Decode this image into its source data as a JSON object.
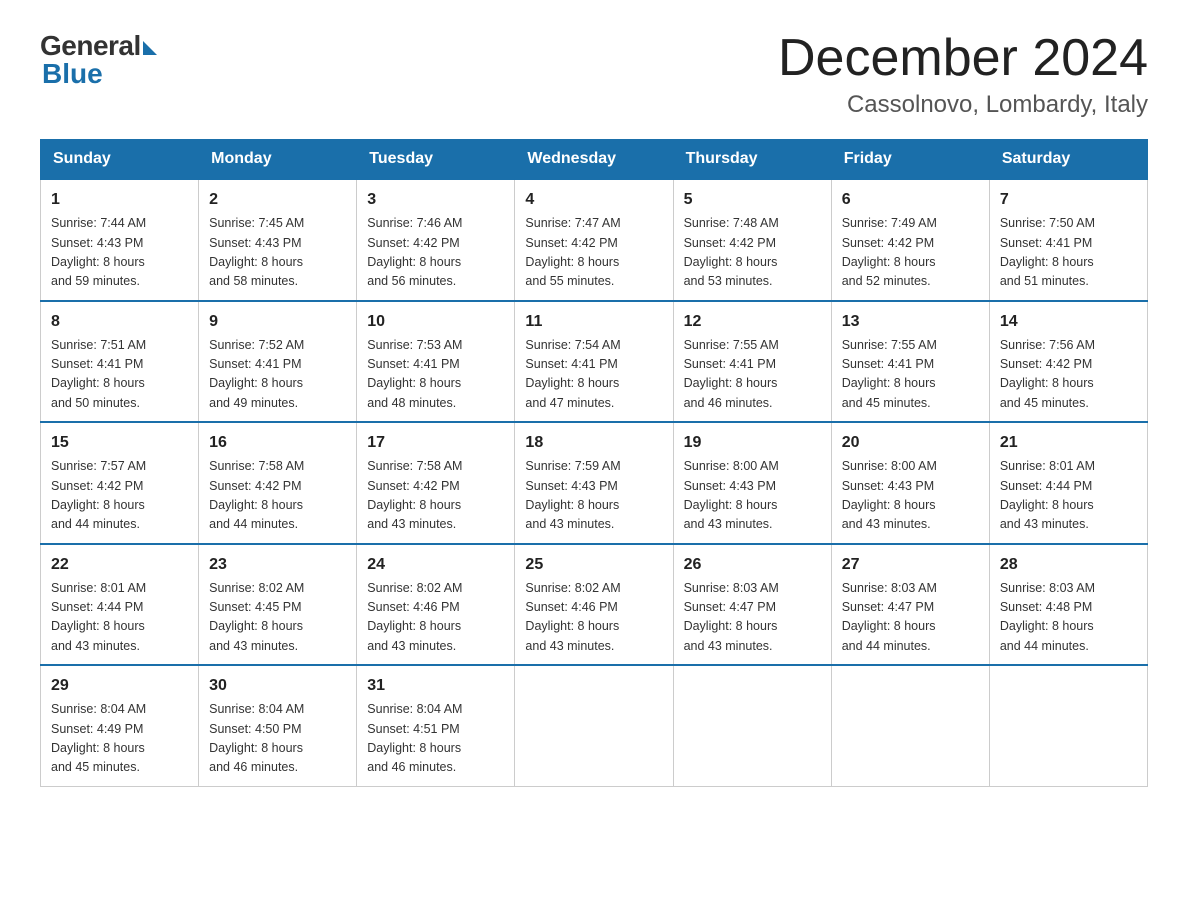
{
  "header": {
    "logo_general": "General",
    "logo_blue": "Blue",
    "month_title": "December 2024",
    "location": "Cassolnovo, Lombardy, Italy"
  },
  "days_of_week": [
    "Sunday",
    "Monday",
    "Tuesday",
    "Wednesday",
    "Thursday",
    "Friday",
    "Saturday"
  ],
  "weeks": [
    [
      {
        "day": "1",
        "sunrise": "7:44 AM",
        "sunset": "4:43 PM",
        "daylight": "8 hours and 59 minutes."
      },
      {
        "day": "2",
        "sunrise": "7:45 AM",
        "sunset": "4:43 PM",
        "daylight": "8 hours and 58 minutes."
      },
      {
        "day": "3",
        "sunrise": "7:46 AM",
        "sunset": "4:42 PM",
        "daylight": "8 hours and 56 minutes."
      },
      {
        "day": "4",
        "sunrise": "7:47 AM",
        "sunset": "4:42 PM",
        "daylight": "8 hours and 55 minutes."
      },
      {
        "day": "5",
        "sunrise": "7:48 AM",
        "sunset": "4:42 PM",
        "daylight": "8 hours and 53 minutes."
      },
      {
        "day": "6",
        "sunrise": "7:49 AM",
        "sunset": "4:42 PM",
        "daylight": "8 hours and 52 minutes."
      },
      {
        "day": "7",
        "sunrise": "7:50 AM",
        "sunset": "4:41 PM",
        "daylight": "8 hours and 51 minutes."
      }
    ],
    [
      {
        "day": "8",
        "sunrise": "7:51 AM",
        "sunset": "4:41 PM",
        "daylight": "8 hours and 50 minutes."
      },
      {
        "day": "9",
        "sunrise": "7:52 AM",
        "sunset": "4:41 PM",
        "daylight": "8 hours and 49 minutes."
      },
      {
        "day": "10",
        "sunrise": "7:53 AM",
        "sunset": "4:41 PM",
        "daylight": "8 hours and 48 minutes."
      },
      {
        "day": "11",
        "sunrise": "7:54 AM",
        "sunset": "4:41 PM",
        "daylight": "8 hours and 47 minutes."
      },
      {
        "day": "12",
        "sunrise": "7:55 AM",
        "sunset": "4:41 PM",
        "daylight": "8 hours and 46 minutes."
      },
      {
        "day": "13",
        "sunrise": "7:55 AM",
        "sunset": "4:41 PM",
        "daylight": "8 hours and 45 minutes."
      },
      {
        "day": "14",
        "sunrise": "7:56 AM",
        "sunset": "4:42 PM",
        "daylight": "8 hours and 45 minutes."
      }
    ],
    [
      {
        "day": "15",
        "sunrise": "7:57 AM",
        "sunset": "4:42 PM",
        "daylight": "8 hours and 44 minutes."
      },
      {
        "day": "16",
        "sunrise": "7:58 AM",
        "sunset": "4:42 PM",
        "daylight": "8 hours and 44 minutes."
      },
      {
        "day": "17",
        "sunrise": "7:58 AM",
        "sunset": "4:42 PM",
        "daylight": "8 hours and 43 minutes."
      },
      {
        "day": "18",
        "sunrise": "7:59 AM",
        "sunset": "4:43 PM",
        "daylight": "8 hours and 43 minutes."
      },
      {
        "day": "19",
        "sunrise": "8:00 AM",
        "sunset": "4:43 PM",
        "daylight": "8 hours and 43 minutes."
      },
      {
        "day": "20",
        "sunrise": "8:00 AM",
        "sunset": "4:43 PM",
        "daylight": "8 hours and 43 minutes."
      },
      {
        "day": "21",
        "sunrise": "8:01 AM",
        "sunset": "4:44 PM",
        "daylight": "8 hours and 43 minutes."
      }
    ],
    [
      {
        "day": "22",
        "sunrise": "8:01 AM",
        "sunset": "4:44 PM",
        "daylight": "8 hours and 43 minutes."
      },
      {
        "day": "23",
        "sunrise": "8:02 AM",
        "sunset": "4:45 PM",
        "daylight": "8 hours and 43 minutes."
      },
      {
        "day": "24",
        "sunrise": "8:02 AM",
        "sunset": "4:46 PM",
        "daylight": "8 hours and 43 minutes."
      },
      {
        "day": "25",
        "sunrise": "8:02 AM",
        "sunset": "4:46 PM",
        "daylight": "8 hours and 43 minutes."
      },
      {
        "day": "26",
        "sunrise": "8:03 AM",
        "sunset": "4:47 PM",
        "daylight": "8 hours and 43 minutes."
      },
      {
        "day": "27",
        "sunrise": "8:03 AM",
        "sunset": "4:47 PM",
        "daylight": "8 hours and 44 minutes."
      },
      {
        "day": "28",
        "sunrise": "8:03 AM",
        "sunset": "4:48 PM",
        "daylight": "8 hours and 44 minutes."
      }
    ],
    [
      {
        "day": "29",
        "sunrise": "8:04 AM",
        "sunset": "4:49 PM",
        "daylight": "8 hours and 45 minutes."
      },
      {
        "day": "30",
        "sunrise": "8:04 AM",
        "sunset": "4:50 PM",
        "daylight": "8 hours and 46 minutes."
      },
      {
        "day": "31",
        "sunrise": "8:04 AM",
        "sunset": "4:51 PM",
        "daylight": "8 hours and 46 minutes."
      },
      null,
      null,
      null,
      null
    ]
  ],
  "labels": {
    "sunrise": "Sunrise:",
    "sunset": "Sunset:",
    "daylight": "Daylight:"
  }
}
